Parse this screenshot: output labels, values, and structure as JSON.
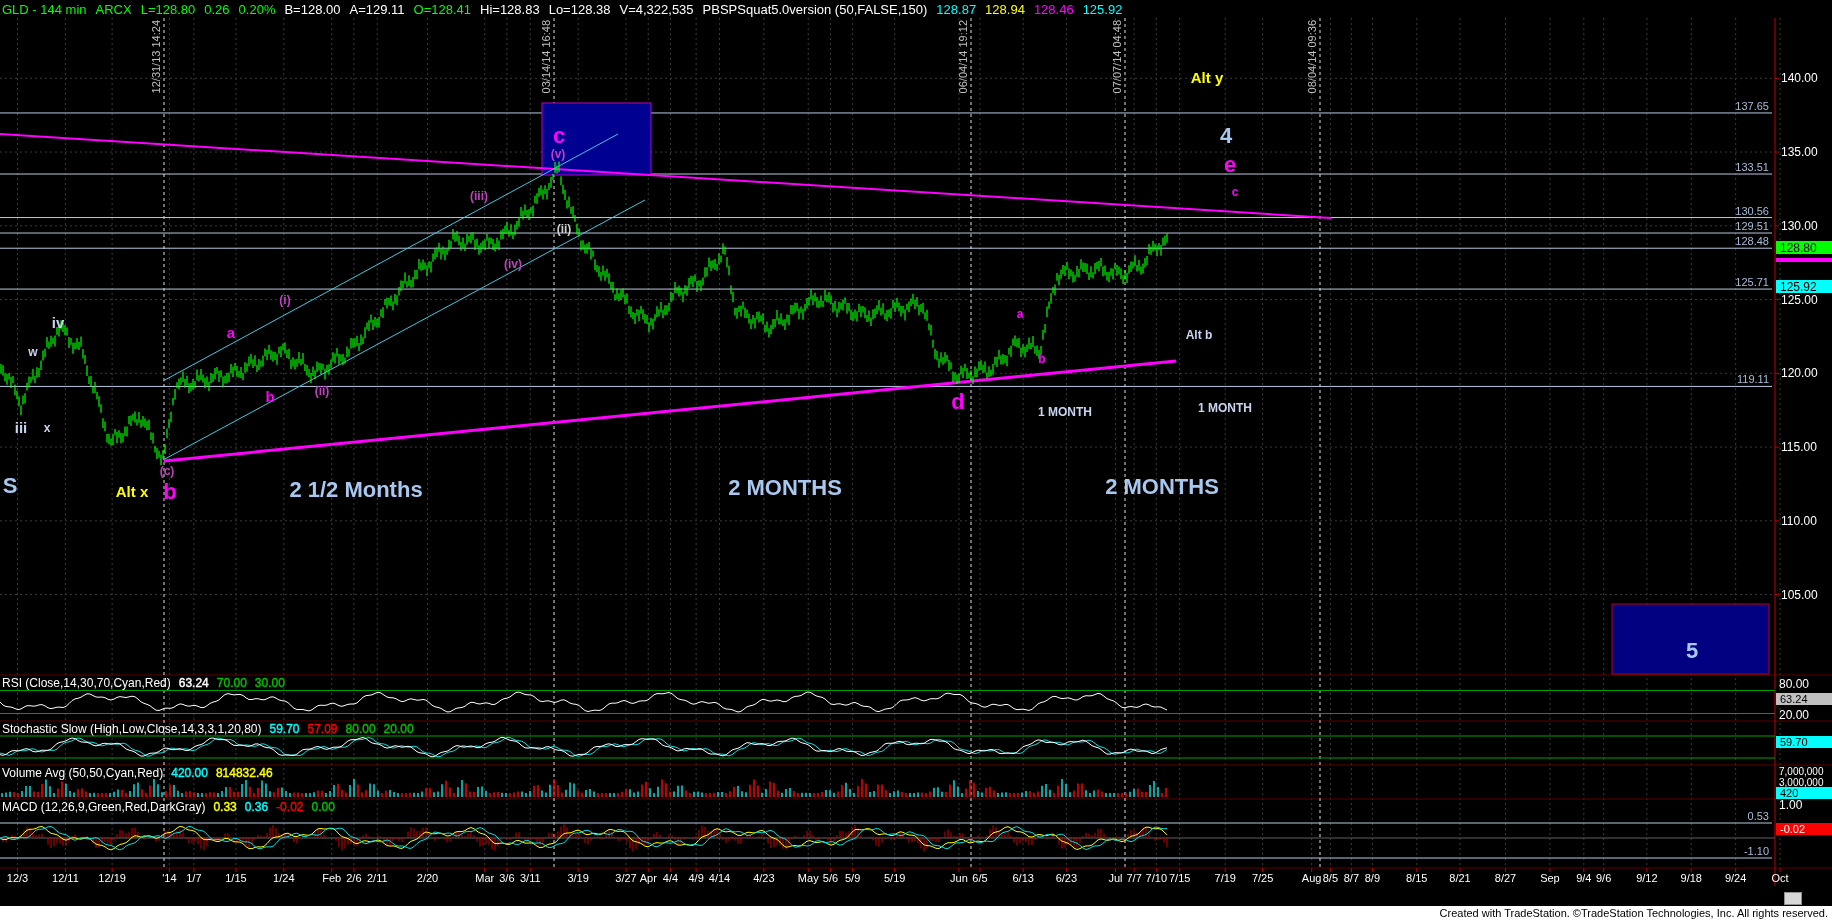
{
  "header": [
    {
      "text": "GLD - 144 min",
      "color": "#00ff00"
    },
    {
      "text": "ARCX",
      "color": "#00ff00"
    },
    {
      "text": "L=128.80",
      "color": "#00ff00"
    },
    {
      "text": "0.26",
      "color": "#00ff00"
    },
    {
      "text": "0.20%",
      "color": "#00ff00"
    },
    {
      "text": "B=128.00",
      "color": "#ffffff"
    },
    {
      "text": "A=129.11",
      "color": "#ffffff"
    },
    {
      "text": "O=128.41",
      "color": "#00ff00"
    },
    {
      "text": "Hi=128.83",
      "color": "#ffffff"
    },
    {
      "text": "Lo=128.38",
      "color": "#ffffff"
    },
    {
      "text": "V=4,322,535",
      "color": "#ffffff"
    },
    {
      "text": "PBSPSquat5.0version (50,FALSE,150)",
      "color": "#ffffff"
    },
    {
      "text": "128.87",
      "color": "#00ffff"
    },
    {
      "text": "128.94",
      "color": "#ffff00"
    },
    {
      "text": "128.46",
      "color": "#ff00ff"
    },
    {
      "text": "125.92",
      "color": "#00ffff"
    }
  ],
  "timestamps": [
    "12/31/13 14:24",
    "03/14/14 16:48",
    "06/04/14 19:12",
    "07/07/14 04:48",
    "08/04/14 09:36"
  ],
  "level_lines": [
    "137.65",
    "133.51",
    "130.56",
    "129.51",
    "128.48",
    "125.71",
    "119.11"
  ],
  "annotations": [
    {
      "text": "Alt y",
      "color": "#ffff00",
      "kind": "medium"
    },
    {
      "text": "c",
      "color": "#ff00ff",
      "kind": "big"
    },
    {
      "text": "4",
      "color": "#a8c8f0",
      "kind": "big"
    },
    {
      "text": "(v)",
      "color": "#c040c0",
      "kind": "tiny"
    },
    {
      "text": "e",
      "color": "#ff00ff",
      "kind": "big"
    },
    {
      "text": "(iii)",
      "color": "#c040c0",
      "kind": "tiny"
    },
    {
      "text": "c",
      "color": "#ff00ff",
      "kind": "tiny"
    },
    {
      "text": "(ii)",
      "color": "#d0d0d0",
      "kind": "tiny"
    },
    {
      "text": "(iv)",
      "color": "#c040c0",
      "kind": "tiny"
    },
    {
      "text": "(i)",
      "color": "#c040c0",
      "kind": "tiny"
    },
    {
      "text": "a",
      "color": "#ff00ff",
      "kind": "tiny"
    },
    {
      "text": "iv",
      "color": "#c8d4f0",
      "kind": "medium"
    },
    {
      "text": "a",
      "color": "#ff00ff",
      "kind": "medium"
    },
    {
      "text": "Alt b",
      "color": "#c8d4f0",
      "kind": "small"
    },
    {
      "text": "w",
      "color": "#c8d4f0",
      "kind": "small"
    },
    {
      "text": "b",
      "color": "#ff00ff",
      "kind": "tiny"
    },
    {
      "text": "b",
      "color": "#ff00ff",
      "kind": "medium"
    },
    {
      "text": "(ii)",
      "color": "#c040c0",
      "kind": "tiny"
    },
    {
      "text": "d",
      "color": "#ff00ff",
      "kind": "big"
    },
    {
      "text": "1 MONTH",
      "color": "#c8d4f0",
      "kind": "small"
    },
    {
      "text": "1 MONTH",
      "color": "#c8d4f0",
      "kind": "small"
    },
    {
      "text": "iii",
      "color": "#c8d4f0",
      "kind": "medium"
    },
    {
      "text": "x",
      "color": "#c8d4f0",
      "kind": "small"
    },
    {
      "text": "(c)",
      "color": "#c040c0",
      "kind": "tiny"
    },
    {
      "text": "S",
      "color": "#a8c8f0",
      "kind": "big"
    },
    {
      "text": "Alt x",
      "color": "#ffff00",
      "kind": "medium"
    },
    {
      "text": "b",
      "color": "#ff00ff",
      "kind": "big"
    },
    {
      "text": "2 1/2 Months",
      "color": "#a8c8f0",
      "kind": "big"
    },
    {
      "text": "2 MONTHS",
      "color": "#a8c8f0",
      "kind": "big"
    },
    {
      "text": "2 MONTHS",
      "color": "#a8c8f0",
      "kind": "big"
    },
    {
      "text": "5",
      "color": "#a8c8f0",
      "kind": "big"
    }
  ],
  "price_axis": {
    "ticks": [
      "140.00",
      "135.00",
      "130.00",
      "125.00",
      "120.00",
      "115.00",
      "110.00",
      "105.00"
    ],
    "badges": [
      {
        "text": "128.80",
        "color": "#00ff00"
      },
      {
        "color": "#ff00ff"
      },
      {
        "text": "125.92",
        "color": "#00ffff"
      }
    ]
  },
  "indicators": [
    {
      "label": "RSI (Close,14,30,70,Cyan,Red)",
      "values": [
        {
          "text": "63.24",
          "color": "#ffffff"
        },
        {
          "text": "70.00",
          "color": "#00c000"
        },
        {
          "text": "30.00",
          "color": "#00c000"
        }
      ],
      "axis": [
        "80.00",
        "20.00"
      ],
      "badge": {
        "text": "63.24",
        "color": "#c0c0c0"
      }
    },
    {
      "label": "Stochastic Slow (High,Low,Close,14,3,3,1,20,80)",
      "values": [
        {
          "text": "59.70",
          "color": "#00ffff"
        },
        {
          "text": "57.09",
          "color": "#ff0000"
        },
        {
          "text": "80.00",
          "color": "#00c000"
        },
        {
          "text": "20.00",
          "color": "#00c000"
        }
      ],
      "badge": {
        "text": "59.70",
        "color": "#00ffff"
      }
    },
    {
      "label": "Volume Avg (50,50,Cyan,Red)",
      "values": [
        {
          "text": "420.00",
          "color": "#00ffff"
        },
        {
          "text": "814832.46",
          "color": "#ffff00"
        }
      ],
      "axis": [
        "7,000,000",
        "3,000,000"
      ],
      "badge": {
        "text": "420",
        "color": "#00ffff"
      }
    },
    {
      "label": "MACD (12,26,9,Green,Red,DarkGray)",
      "values": [
        {
          "text": "0.33",
          "color": "#ffff00"
        },
        {
          "text": "0.36",
          "color": "#00ffff"
        },
        {
          "text": "-0.02",
          "color": "#ff0000"
        },
        {
          "text": "0.00",
          "color": "#00c000"
        }
      ],
      "axis": [
        "1.00"
      ],
      "badge": {
        "text": "-0.02",
        "color": "#ff0000"
      },
      "lines": [
        "0.53",
        "-1.10"
      ]
    }
  ],
  "dates": [
    "12/3",
    "12/11",
    "12/19",
    "'14",
    "1/7",
    "1/15",
    "1/24",
    "Feb",
    "2/6",
    "2/11",
    "2/20",
    "Mar",
    "3/6",
    "3/11",
    "3/19",
    "3/27",
    "Apr",
    "4/4",
    "4/9",
    "4/14",
    "4/23",
    "May",
    "5/6",
    "5/9",
    "5/19",
    "Jun",
    "6/5",
    "6/13",
    "6/23",
    "Jul",
    "7/7",
    "7/10",
    "7/15",
    "7/19",
    "7/25",
    "Aug",
    "8/5",
    "8/7",
    "8/9",
    "8/15",
    "8/21",
    "8/27",
    "Sep",
    "9/4",
    "9/6",
    "9/12",
    "9/18",
    "9/24",
    "Oct"
  ],
  "footer": "Created with TradeStation. ©TradeStation Technologies, Inc. All rights reserved."
}
